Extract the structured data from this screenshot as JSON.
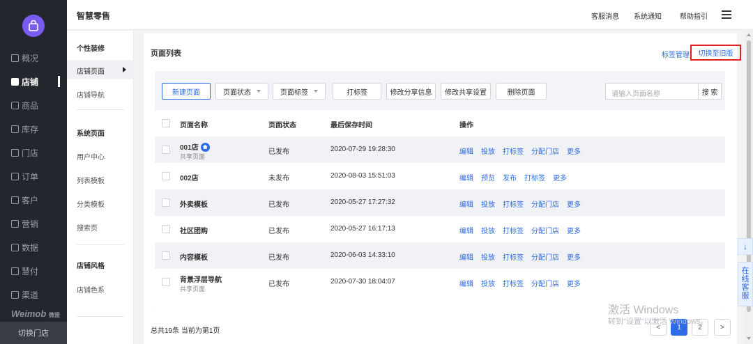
{
  "app": {
    "title": "智慧零售"
  },
  "header": {
    "links": [
      "客服消息",
      "系统通知",
      "帮助指引"
    ]
  },
  "nav": {
    "items": [
      {
        "label": "概况",
        "icon": "dashboard-icon"
      },
      {
        "label": "店铺",
        "icon": "store-icon",
        "active": true
      },
      {
        "label": "商品",
        "icon": "goods-icon"
      },
      {
        "label": "库存",
        "icon": "inventory-icon"
      },
      {
        "label": "门店",
        "icon": "outlet-icon"
      },
      {
        "label": "订单",
        "icon": "order-icon"
      },
      {
        "label": "客户",
        "icon": "customer-icon"
      },
      {
        "label": "营销",
        "icon": "marketing-icon"
      },
      {
        "label": "数据",
        "icon": "data-icon"
      },
      {
        "label": "慧付",
        "icon": "pay-icon"
      },
      {
        "label": "渠道",
        "icon": "channel-icon"
      }
    ],
    "brand": "Weimob",
    "brand_sub": "微盟",
    "switch_store": "切换门店"
  },
  "subnav": {
    "group1": "个性装修",
    "active": "店铺页面",
    "item_nav": "店铺导航",
    "group2": "系统页面",
    "items2": [
      "用户中心",
      "列表模板",
      "分类模板",
      "搜索页"
    ],
    "group3": "店铺风格",
    "item_color": "店铺色系"
  },
  "page": {
    "title": "页面列表",
    "tag_mgmt": "标签管理",
    "switch_old": "切换至旧版"
  },
  "toolbar": {
    "new_page": "新建页面",
    "status_filter": "页面状态",
    "tag_filter": "页面标签",
    "tag_action": "打标签",
    "edit_share": "修改分享信息",
    "edit_shared": "修改共享设置",
    "delete": "删除页面",
    "search_placeholder": "请输入页面名称",
    "search": "搜 索"
  },
  "table": {
    "headers": [
      "页面名称",
      "页面状态",
      "最后保存时间",
      "操作"
    ],
    "rows": [
      {
        "name": "001店",
        "sub": "共享页面",
        "home": true,
        "status": "已发布",
        "time": "2020-07-29 19:28:30",
        "ops": [
          "编辑",
          "投放",
          "打标签",
          "分配门店",
          "更多"
        ]
      },
      {
        "name": "002店",
        "sub": "",
        "status": "未发布",
        "time": "2020-08-03 15:51:03",
        "ops": [
          "编辑",
          "预览",
          "发布",
          "打标签",
          "更多"
        ]
      },
      {
        "name": "外卖模板",
        "sub": "",
        "status": "已发布",
        "time": "2020-05-27 17:27:32",
        "ops": [
          "编辑",
          "投放",
          "打标签",
          "分配门店",
          "更多"
        ]
      },
      {
        "name": "社区团购",
        "sub": "",
        "status": "已发布",
        "time": "2020-05-27 16:17:13",
        "ops": [
          "编辑",
          "投放",
          "打标签",
          "分配门店",
          "更多"
        ]
      },
      {
        "name": "内容模板",
        "sub": "",
        "status": "已发布",
        "time": "2020-06-03 14:33:10",
        "ops": [
          "编辑",
          "投放",
          "打标签",
          "分配门店",
          "更多"
        ]
      },
      {
        "name": "背景浮层导航",
        "sub": "共享页面",
        "status": "已发布",
        "time": "2020-07-30 18:04:07",
        "ops": [
          "编辑",
          "投放",
          "打标签",
          "分配门店",
          "更多"
        ]
      }
    ]
  },
  "footer": {
    "summary": "总共19条 当前为第1页"
  },
  "pagination": {
    "prev": "<",
    "pages": [
      "1",
      "2"
    ],
    "current": "1",
    "next": ">"
  },
  "watermark": {
    "line1": "激活 Windows",
    "line2": "转到\"设置\"以激活 Windows。"
  },
  "float": {
    "download": "↓",
    "service": "在线客服"
  },
  "colors": {
    "accent": "#2d6be4",
    "sidebar": "#24262e",
    "highlight": "#e02020"
  }
}
